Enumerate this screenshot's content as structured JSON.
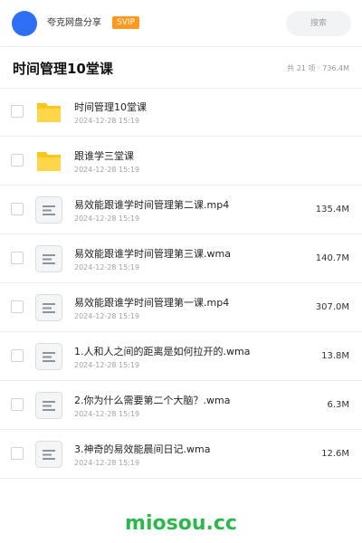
{
  "header": {
    "share_name": "夸克网盘分享",
    "badge": "SVIP",
    "search_placeholder": "搜索"
  },
  "folder": {
    "title": "时间管理10堂课",
    "stats": "共 21 项 · 736.4M"
  },
  "items": [
    {
      "type": "folder",
      "name": "时间管理10堂课",
      "date": "2024-12-28 15:19",
      "size": ""
    },
    {
      "type": "folder",
      "name": "跟谁学三堂课",
      "date": "2024-12-28 15:19",
      "size": ""
    },
    {
      "type": "file",
      "name": "易效能跟谁学时间管理第二课.mp4",
      "date": "2024-12-28 15:19",
      "size": "135.4M"
    },
    {
      "type": "file",
      "name": "易效能跟谁学时间管理第三课.wma",
      "date": "2024-12-28 15:19",
      "size": "140.7M"
    },
    {
      "type": "file",
      "name": "易效能跟谁学时间管理第一课.mp4",
      "date": "2024-12-28 15:19",
      "size": "307.0M"
    },
    {
      "type": "file",
      "name": "1.人和人之间的距离是如何拉开的.wma",
      "date": "2024-12-28 15:19",
      "size": "13.8M"
    },
    {
      "type": "file",
      "name": "2.你为什么需要第二个大脑？.wma",
      "date": "2024-12-28 15:19",
      "size": "6.3M"
    },
    {
      "type": "file",
      "name": "3.神奇的易效能晨间日记.wma",
      "date": "2024-12-28 15:19",
      "size": "12.6M"
    }
  ],
  "watermark": "miosou.cc",
  "colors": {
    "avatar": "#2f6ff5",
    "badge": "#ff9a1f",
    "folder": "#ffc61a",
    "watermark": "#2db84d"
  }
}
